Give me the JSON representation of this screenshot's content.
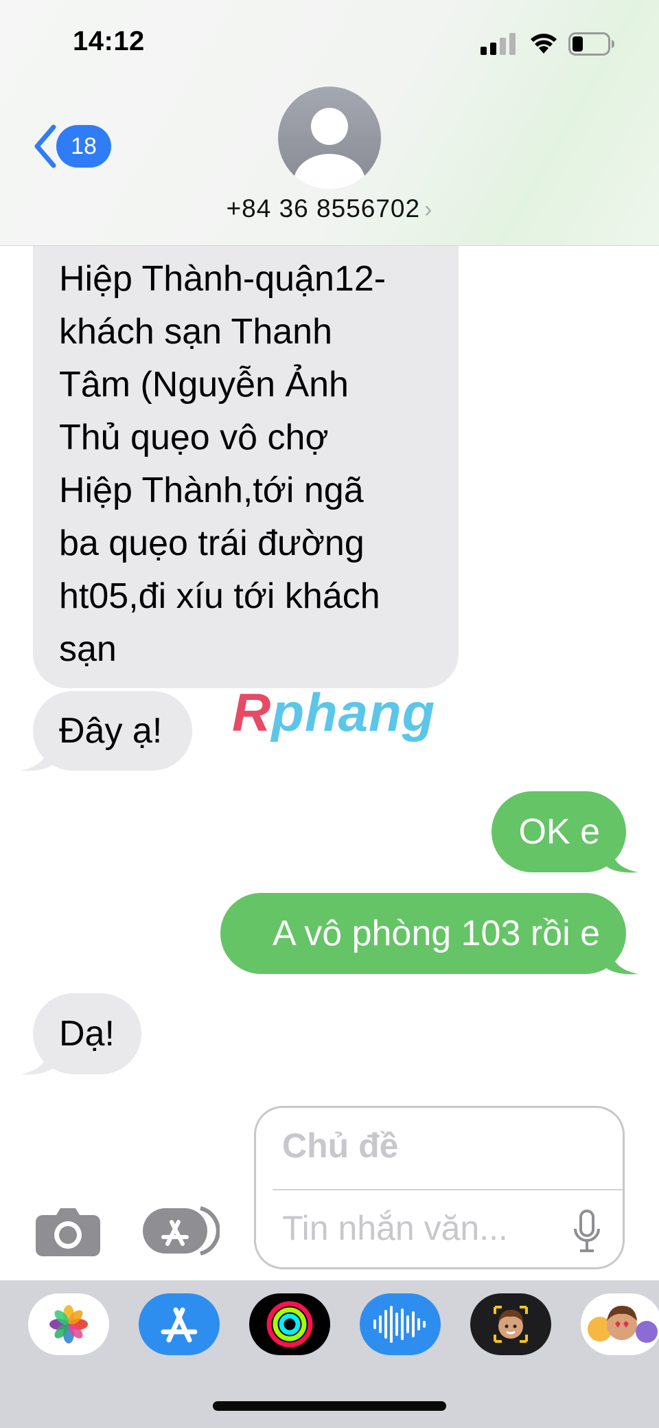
{
  "status_bar": {
    "time": "14:12"
  },
  "nav": {
    "back_count": "18",
    "contact": "+84 36 8556702",
    "chevron": "›"
  },
  "messages": [
    {
      "dir": "in",
      "text": "Hiệp Thành-quận12-\nkhách sạn Thanh\nTâm (Nguyễn Ảnh\nThủ quẹo vô chợ\nHiệp Thành,tới ngã\nba quẹo trái đường\nht05,đi xíu tới khách\nsạn"
    },
    {
      "dir": "in",
      "text": "Đây ạ!"
    },
    {
      "dir": "out",
      "text": "OK e"
    },
    {
      "dir": "out",
      "text": "A vô phòng 103 rồi e"
    },
    {
      "dir": "in",
      "text": "Dạ!"
    }
  ],
  "watermark": {
    "first": "R",
    "rest": "phang"
  },
  "compose": {
    "subject_placeholder": "Chủ đề",
    "message_placeholder": "Tin nhắn văn..."
  },
  "icons": [
    "camera-icon",
    "app-store-icon",
    "mic-icon",
    "photos-app-icon",
    "app-store-app-icon",
    "fitness-app-icon",
    "audio-app-icon",
    "memoji-app-icon",
    "animoji-app-icon"
  ],
  "colors": {
    "accent": "#2f7cf6",
    "sent_bubble": "#65c466",
    "received_bubble": "#e9e9eb"
  }
}
